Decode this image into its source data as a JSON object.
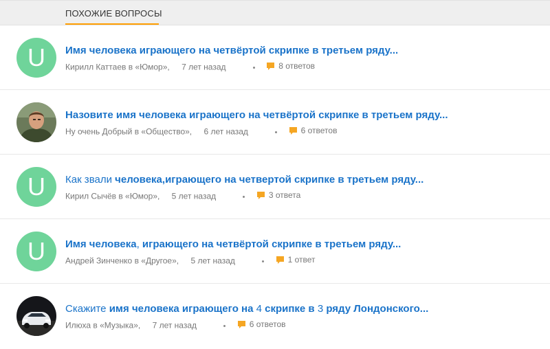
{
  "section": {
    "title": "ПОХОЖИЕ ВОПРОСЫ"
  },
  "colors": {
    "accent": "#ff9e00",
    "link": "#1a73c9",
    "avatar_green": "#6fd49a"
  },
  "items": [
    {
      "avatar": {
        "type": "letter",
        "letter": "U"
      },
      "title_parts": [
        {
          "text": "Имя человека играющего на четвёртой скрипке в третьем ряду...",
          "bold": true
        }
      ],
      "author": "Кирилл Каттаев",
      "category": "в «Юмор»,",
      "time": "7 лет назад",
      "answers": "8 ответов"
    },
    {
      "avatar": {
        "type": "photo",
        "icon": "user-photo-man"
      },
      "title_parts": [
        {
          "text": "Назовите имя человека играющего на четвёртой скрипке в третьем ряду...",
          "bold": true
        }
      ],
      "author": "Ну очень Добрый",
      "category": "в «Общество»,",
      "time": "6 лет назад",
      "answers": "6 ответов"
    },
    {
      "avatar": {
        "type": "letter",
        "letter": "U"
      },
      "title_parts": [
        {
          "text": "Как звали ",
          "bold": false
        },
        {
          "text": "человека,играющего на четвертой скрипке в третьем ряду...",
          "bold": true
        }
      ],
      "author": "Кирил Сычёв",
      "category": "в «Юмор»,",
      "time": "5 лет назад",
      "answers": "3 ответа"
    },
    {
      "avatar": {
        "type": "letter",
        "letter": "U"
      },
      "title_parts": [
        {
          "text": "Имя человека",
          "bold": true
        },
        {
          "text": ", ",
          "bold": false
        },
        {
          "text": "играющего на четвёртой скрипке в третьем ряду...",
          "bold": true
        }
      ],
      "author": "Андрей Зинченко",
      "category": "в «Другое»,",
      "time": "5 лет назад",
      "answers": "1 ответ"
    },
    {
      "avatar": {
        "type": "photo",
        "icon": "user-photo-car"
      },
      "title_parts": [
        {
          "text": "Скажите ",
          "bold": false
        },
        {
          "text": "имя человека играющего на ",
          "bold": true
        },
        {
          "text": "4 ",
          "bold": false
        },
        {
          "text": "скрипке в ",
          "bold": true
        },
        {
          "text": "3 ",
          "bold": false
        },
        {
          "text": "ряду Лондонского...",
          "bold": true
        }
      ],
      "author": "Илюха",
      "category": "в «Музыка»,",
      "time": "7 лет назад",
      "answers": "6 ответов"
    }
  ]
}
